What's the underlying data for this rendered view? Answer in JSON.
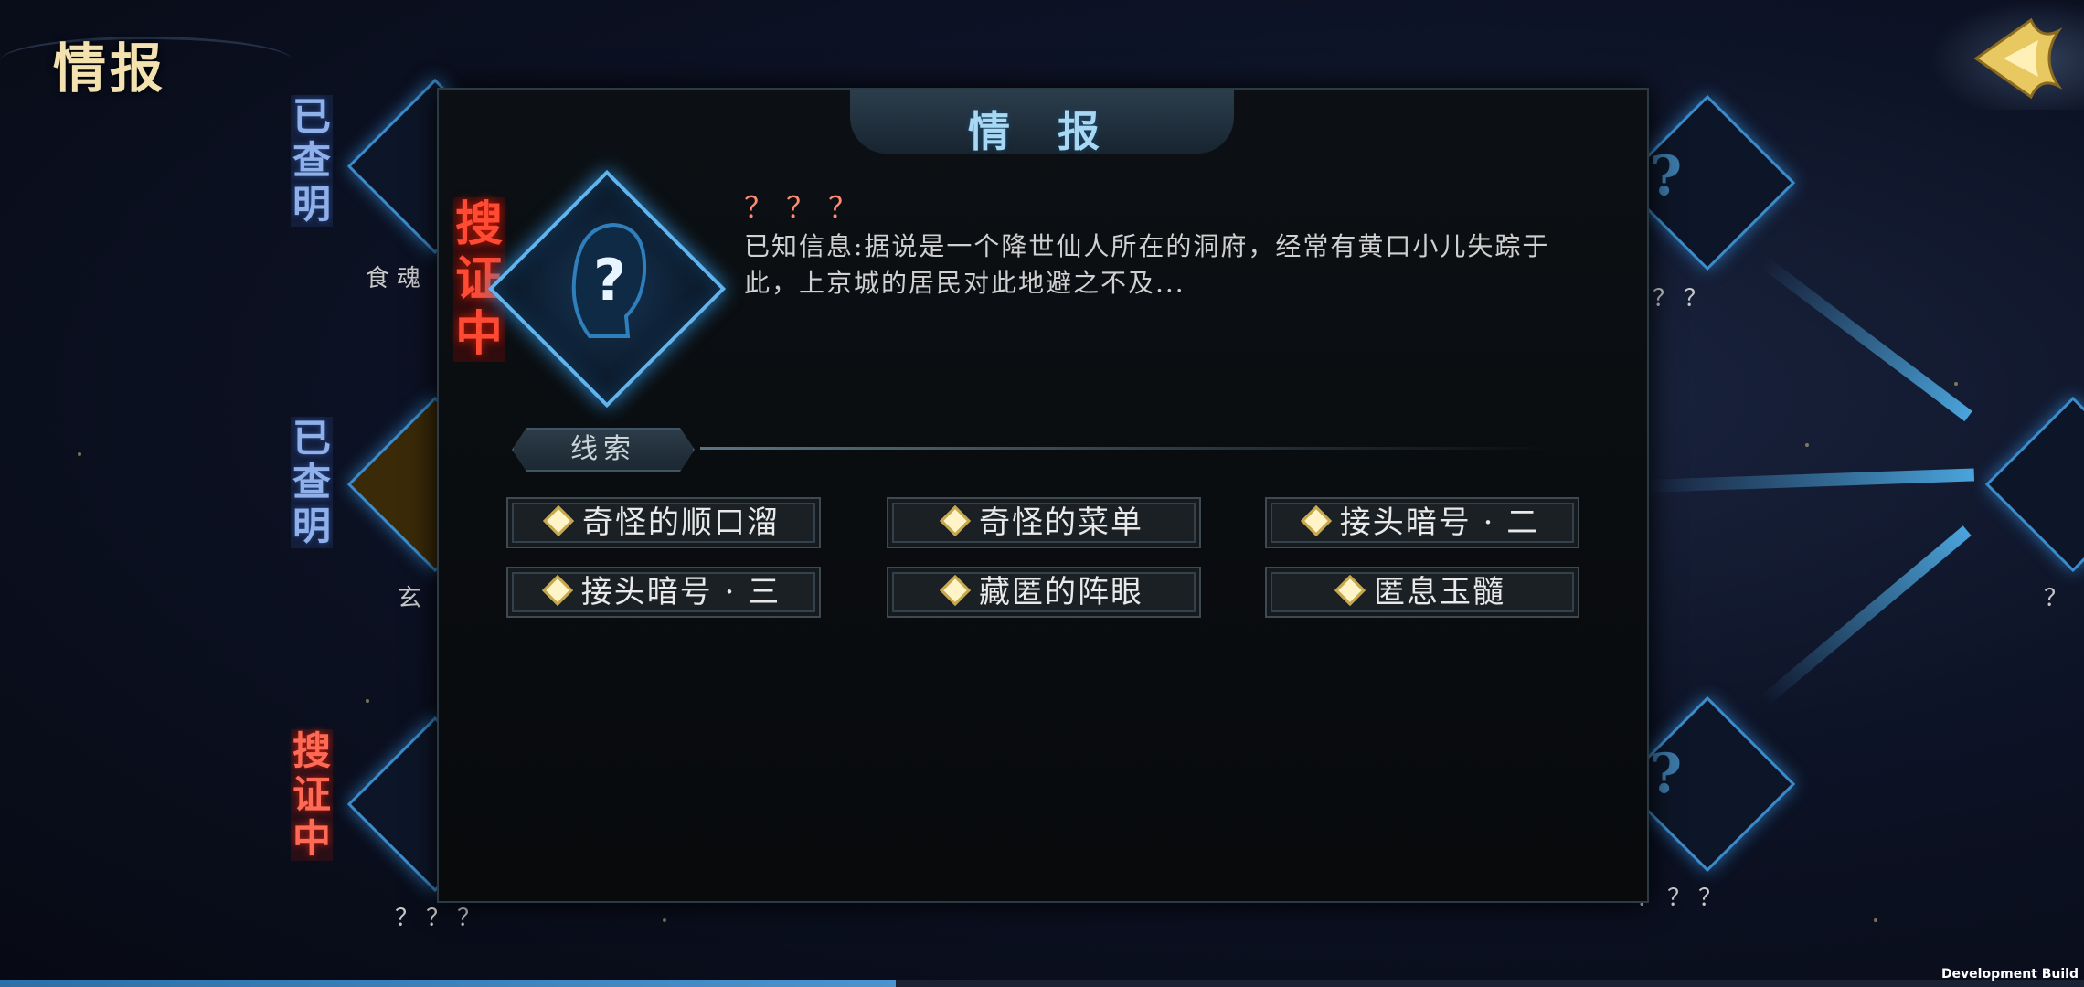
{
  "header": {
    "title": "情报"
  },
  "modal": {
    "title": "情 报",
    "status_tag": "搜证中",
    "target": {
      "name": "？？？",
      "description": "已知信息:据说是一个降世仙人所在的洞府，经常有黄口小儿失踪于此，上京城的居民对此地避之不及..."
    },
    "clues_label": "线索",
    "clues": [
      "奇怪的顺口溜",
      "奇怪的菜单",
      "接头暗号 · 二",
      "接头暗号 · 三",
      "藏匿的阵眼",
      "匿息玉髓"
    ]
  },
  "background_nodes": [
    {
      "tag": "已查明",
      "label": "食魂"
    },
    {
      "tag": "已查明",
      "label": "玄"
    },
    {
      "tag": "搜证中",
      "label": "？？？"
    },
    {
      "label": "？？"
    },
    {
      "label": "？？？"
    },
    {
      "label": "？"
    }
  ],
  "footer": {
    "dev_build": "Development Build",
    "progress": 0.43
  },
  "colors": {
    "accent": "#61b4ee",
    "status_red": "#ff4a34",
    "gold": "#f3e2b0"
  }
}
